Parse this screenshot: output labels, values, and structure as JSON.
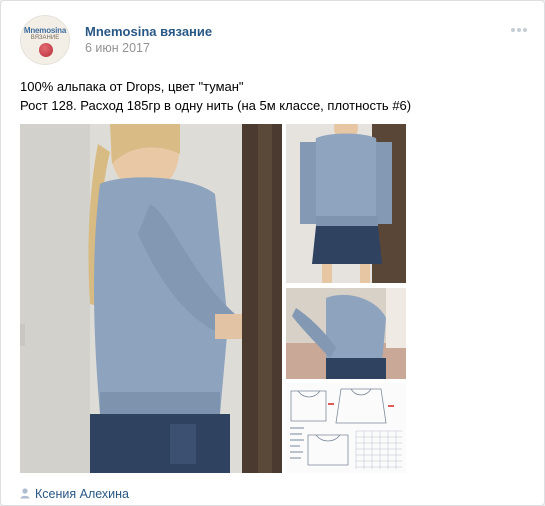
{
  "post": {
    "author": "Mnemosina вязание",
    "date": "6 июн 2017",
    "avatar": {
      "brand_text": "Mnemosina",
      "sub_text": "ВЯЗАНИЕ"
    },
    "text_lines": [
      "100% альпака от Drops, цвет \"туман\"",
      "Рост 128. Расход 185гр в одну нить (на 5м классе, плотность #6)"
    ],
    "photos": [
      {
        "name": "side-view-photo"
      },
      {
        "name": "front-view-photo"
      },
      {
        "name": "sitting-photo"
      },
      {
        "name": "knitting-pattern-photo"
      }
    ],
    "signer": "Ксения Алехина",
    "colors": {
      "link": "#2a5885",
      "meta": "#939393",
      "sweater": "#8ea3bd"
    }
  }
}
